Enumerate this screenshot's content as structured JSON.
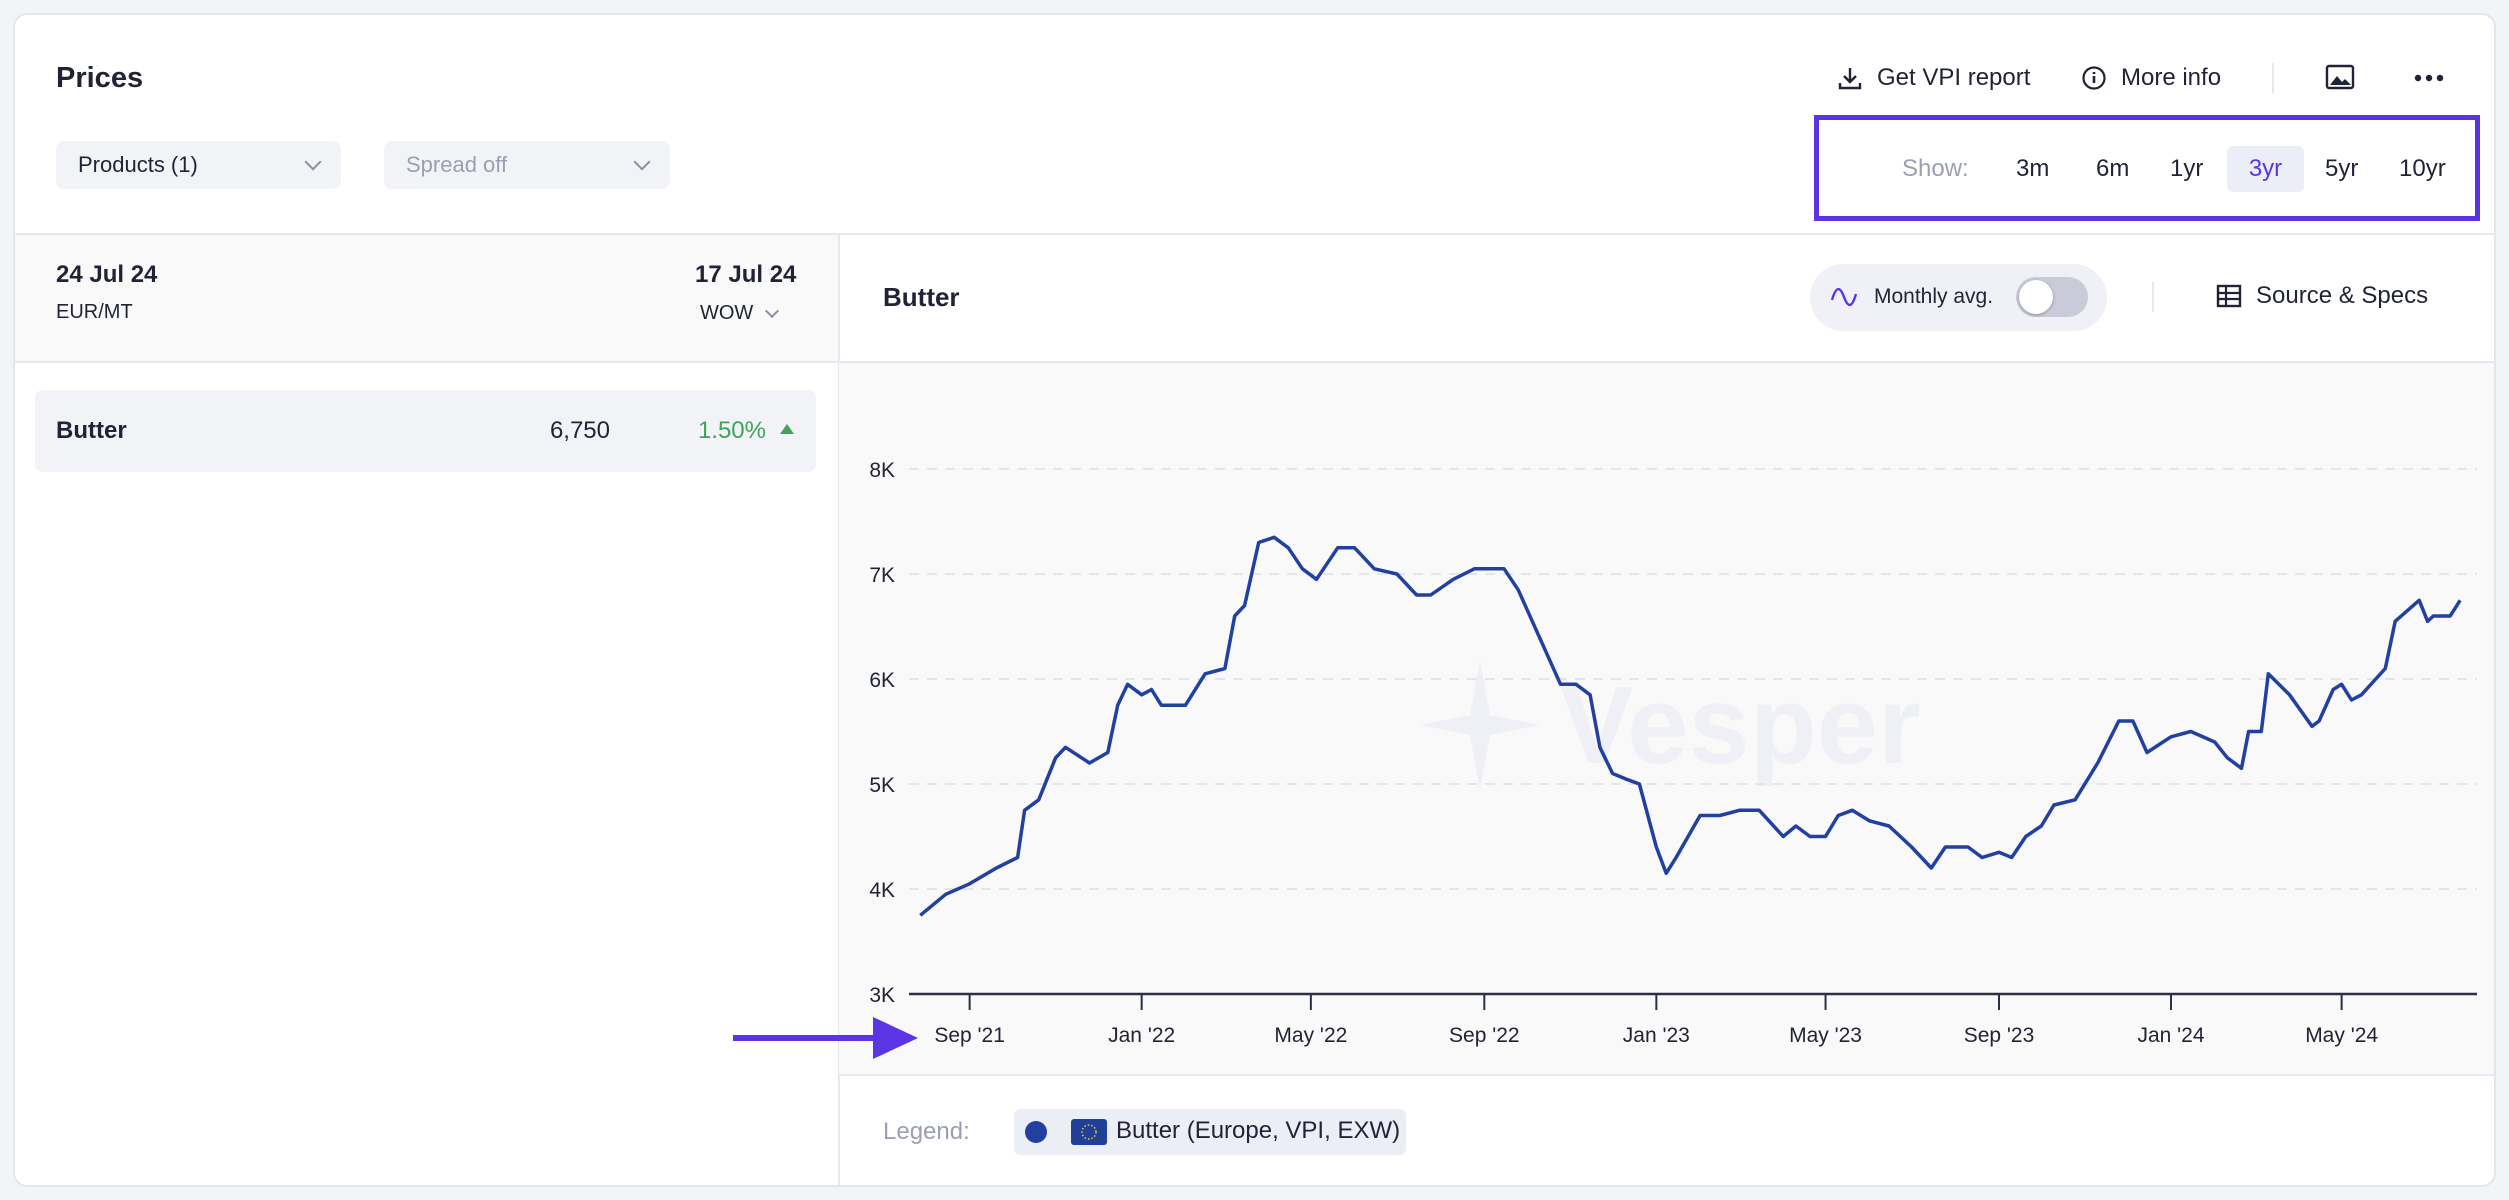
{
  "header": {
    "title": "Prices",
    "get_report": "Get VPI report",
    "more_info": "More info"
  },
  "filters": {
    "products": "Products (1)",
    "spread": "Spread off"
  },
  "range": {
    "label": "Show:",
    "options": [
      "3m",
      "6m",
      "1yr",
      "3yr",
      "5yr",
      "10yr"
    ],
    "selected": "3yr"
  },
  "left": {
    "date_current": "24 Jul 24",
    "unit": "EUR/MT",
    "date_compare": "17 Jul 24",
    "compare_mode": "WOW",
    "rows": [
      {
        "name": "Butter",
        "value": "6,750",
        "change": "1.50%",
        "direction": "up"
      }
    ]
  },
  "chart_header": {
    "title": "Butter",
    "monthly_avg": "Monthly avg.",
    "monthly_avg_on": false,
    "source_specs": "Source & Specs"
  },
  "legend": {
    "label": "Legend:",
    "items": [
      "Butter (Europe, VPI, EXW)"
    ]
  },
  "watermark": "Vesper",
  "colors": {
    "accent": "#5b34e6",
    "line": "#2140a0",
    "positive": "#3fa35b"
  },
  "chart_data": {
    "type": "line",
    "grid": true,
    "y_ticks": [
      "3K",
      "4K",
      "5K",
      "6K",
      "7K",
      "8K"
    ],
    "ylim": [
      3000,
      8000
    ],
    "x_ticks": [
      [
        "2021-09-01",
        "Sep '21"
      ],
      [
        "2022-01-01",
        "Jan '22"
      ],
      [
        "2022-05-01",
        "May '22"
      ],
      [
        "2022-09-01",
        "Sep '22"
      ],
      [
        "2023-01-01",
        "Jan '23"
      ],
      [
        "2023-05-01",
        "May '23"
      ],
      [
        "2023-09-01",
        "Sep '23"
      ],
      [
        "2024-01-01",
        "Jan '24"
      ],
      [
        "2024-05-01",
        "May '24"
      ]
    ],
    "xlim": [
      "2021-07-20",
      "2024-08-05"
    ],
    "series": [
      {
        "name": "Butter (Europe, VPI, EXW)",
        "points": [
          [
            "2021-07-28",
            3750
          ],
          [
            "2021-08-15",
            3950
          ],
          [
            "2021-09-01",
            4050
          ],
          [
            "2021-09-20",
            4200
          ],
          [
            "2021-10-05",
            4300
          ],
          [
            "2021-10-10",
            4750
          ],
          [
            "2021-10-20",
            4850
          ],
          [
            "2021-11-01",
            5250
          ],
          [
            "2021-11-08",
            5350
          ],
          [
            "2021-11-25",
            5200
          ],
          [
            "2021-12-08",
            5300
          ],
          [
            "2021-12-15",
            5750
          ],
          [
            "2021-12-22",
            5950
          ],
          [
            "2022-01-01",
            5850
          ],
          [
            "2022-01-08",
            5900
          ],
          [
            "2022-01-15",
            5750
          ],
          [
            "2022-02-01",
            5750
          ],
          [
            "2022-02-15",
            6050
          ],
          [
            "2022-03-01",
            6100
          ],
          [
            "2022-03-08",
            6600
          ],
          [
            "2022-03-15",
            6700
          ],
          [
            "2022-03-25",
            7300
          ],
          [
            "2022-04-05",
            7350
          ],
          [
            "2022-04-15",
            7250
          ],
          [
            "2022-04-25",
            7050
          ],
          [
            "2022-05-05",
            6950
          ],
          [
            "2022-05-20",
            7250
          ],
          [
            "2022-06-01",
            7250
          ],
          [
            "2022-06-15",
            7050
          ],
          [
            "2022-07-01",
            7000
          ],
          [
            "2022-07-15",
            6800
          ],
          [
            "2022-07-25",
            6800
          ],
          [
            "2022-08-10",
            6950
          ],
          [
            "2022-08-25",
            7050
          ],
          [
            "2022-09-15",
            7050
          ],
          [
            "2022-09-25",
            6850
          ],
          [
            "2022-10-05",
            6550
          ],
          [
            "2022-10-15",
            6250
          ],
          [
            "2022-10-25",
            5950
          ],
          [
            "2022-11-05",
            5950
          ],
          [
            "2022-11-15",
            5850
          ],
          [
            "2022-11-22",
            5350
          ],
          [
            "2022-12-01",
            5100
          ],
          [
            "2022-12-10",
            5050
          ],
          [
            "2022-12-20",
            5000
          ],
          [
            "2023-01-01",
            4400
          ],
          [
            "2023-01-08",
            4150
          ],
          [
            "2023-01-15",
            4300
          ],
          [
            "2023-02-01",
            4700
          ],
          [
            "2023-02-15",
            4700
          ],
          [
            "2023-03-01",
            4750
          ],
          [
            "2023-03-15",
            4750
          ],
          [
            "2023-04-01",
            4500
          ],
          [
            "2023-04-10",
            4600
          ],
          [
            "2023-04-20",
            4500
          ],
          [
            "2023-05-01",
            4500
          ],
          [
            "2023-05-10",
            4700
          ],
          [
            "2023-05-20",
            4750
          ],
          [
            "2023-06-01",
            4650
          ],
          [
            "2023-06-15",
            4600
          ],
          [
            "2023-07-01",
            4400
          ],
          [
            "2023-07-15",
            4200
          ],
          [
            "2023-07-25",
            4400
          ],
          [
            "2023-08-10",
            4400
          ],
          [
            "2023-08-20",
            4300
          ],
          [
            "2023-09-01",
            4350
          ],
          [
            "2023-09-10",
            4300
          ],
          [
            "2023-09-20",
            4500
          ],
          [
            "2023-10-01",
            4600
          ],
          [
            "2023-10-10",
            4800
          ],
          [
            "2023-10-25",
            4850
          ],
          [
            "2023-11-10",
            5200
          ],
          [
            "2023-11-25",
            5600
          ],
          [
            "2023-12-05",
            5600
          ],
          [
            "2023-12-15",
            5300
          ],
          [
            "2024-01-01",
            5450
          ],
          [
            "2024-01-15",
            5500
          ],
          [
            "2024-02-01",
            5400
          ],
          [
            "2024-02-10",
            5250
          ],
          [
            "2024-02-20",
            5150
          ],
          [
            "2024-02-25",
            5500
          ],
          [
            "2024-03-05",
            5500
          ],
          [
            "2024-03-10",
            6050
          ],
          [
            "2024-03-25",
            5850
          ],
          [
            "2024-04-10",
            5550
          ],
          [
            "2024-04-15",
            5600
          ],
          [
            "2024-04-25",
            5900
          ],
          [
            "2024-05-01",
            5950
          ],
          [
            "2024-05-08",
            5800
          ],
          [
            "2024-05-15",
            5850
          ],
          [
            "2024-06-01",
            6100
          ],
          [
            "2024-06-08",
            6550
          ],
          [
            "2024-06-25",
            6750
          ],
          [
            "2024-07-01",
            6550
          ],
          [
            "2024-07-05",
            6600
          ],
          [
            "2024-07-17",
            6600
          ],
          [
            "2024-07-24",
            6750
          ]
        ]
      }
    ]
  }
}
